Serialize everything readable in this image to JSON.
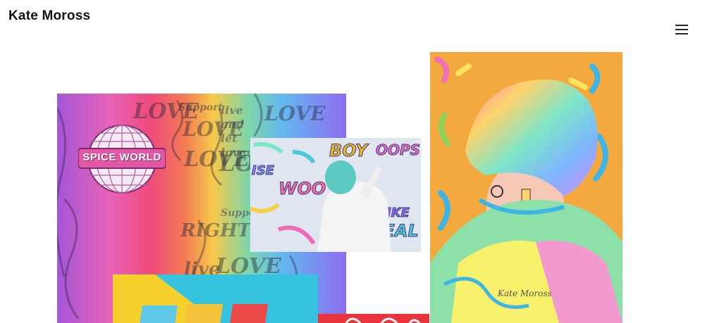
{
  "header": {
    "site_title": "Kate Moross",
    "menu_icon": "hamburger-menu-icon"
  },
  "wall_tile": {
    "globe_text": "SPICE WORLD",
    "lettering": [
      "LOVE",
      "Support",
      "LOVE",
      "live and let love",
      "LOVE",
      "LOVE",
      "RIGHT",
      "LOVE",
      "live",
      "LOVE",
      "Support"
    ]
  },
  "painter_tile": {
    "lettering": [
      "BOY",
      "OOPS",
      "WOO",
      "REAL",
      "YIKE",
      "ISE"
    ]
  },
  "hair_tile": {
    "signature": "Kate Moross"
  },
  "colors": {
    "hair_background": "#f3a93d",
    "notebook_background": "#f6d12e",
    "red_pattern": "#e8343c"
  }
}
